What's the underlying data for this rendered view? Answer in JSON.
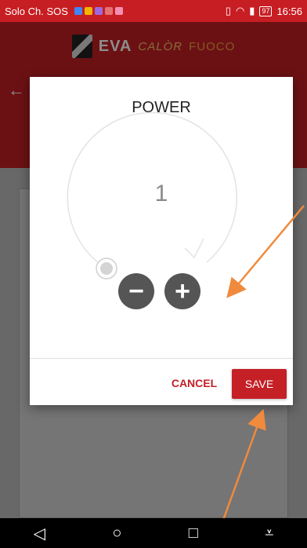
{
  "status_bar": {
    "carrier": "Solo Ch. SOS",
    "battery": "97",
    "time": "16:56"
  },
  "app": {
    "brand_eva": "EVA",
    "brand_calor": "CALÒR",
    "brand_fuoco": "FUOCO"
  },
  "dialog": {
    "title": "POWER",
    "value": "1",
    "minus_label": "−",
    "plus_label": "+",
    "cancel_label": "CANCEL",
    "save_label": "SAVE"
  },
  "colors": {
    "accent": "#c42026",
    "annotation_arrow": "#f08a3c"
  },
  "nav": {
    "back_icon": "◁",
    "home_icon": "○",
    "recents_icon": "□",
    "menu_icon": "⩡"
  }
}
